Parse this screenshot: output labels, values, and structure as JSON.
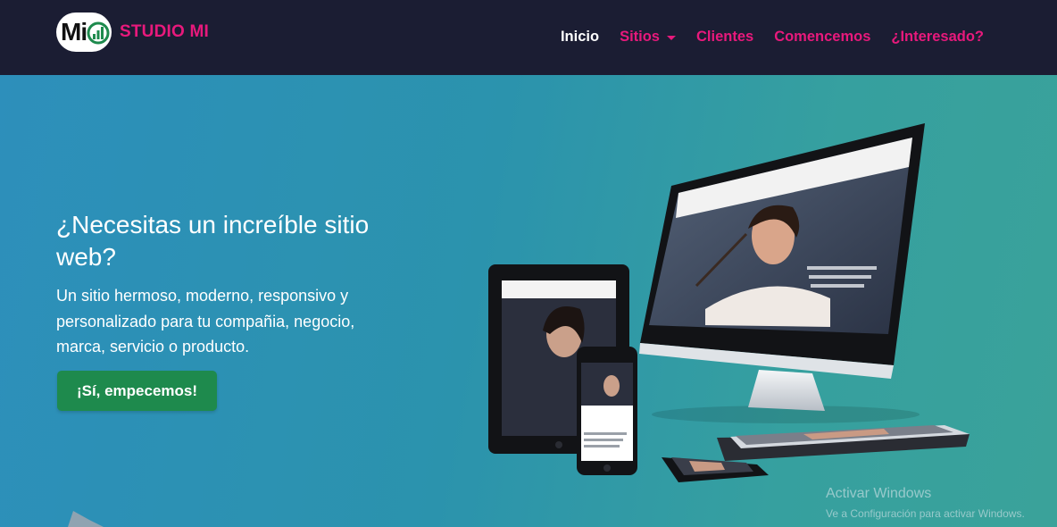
{
  "brand": {
    "logo_text": "Mi",
    "name": "STUDIO MI"
  },
  "nav": {
    "items": [
      {
        "label": "Inicio",
        "active": true
      },
      {
        "label": "Sitios",
        "dropdown": true
      },
      {
        "label": "Clientes"
      },
      {
        "label": "Comencemos"
      },
      {
        "label": "¿Interesado?"
      }
    ]
  },
  "hero": {
    "headline": "¿Necesitas un increíble sitio web?",
    "subtext": "Un sitio hermoso, moderno, responsivo y personalizado para tu compañia, negocio, marca, servicio o producto.",
    "cta_label": "¡Sí, empecemos!"
  },
  "watermark": {
    "title": "Activar Windows",
    "subtitle": "Ve a Configuración para activar Windows."
  },
  "colors": {
    "navbar_bg": "#1b1d33",
    "accent": "#e8197c",
    "cta_bg": "#1e8a4d",
    "hero_start": "#2d8fbb",
    "hero_end": "#3aa29a"
  }
}
